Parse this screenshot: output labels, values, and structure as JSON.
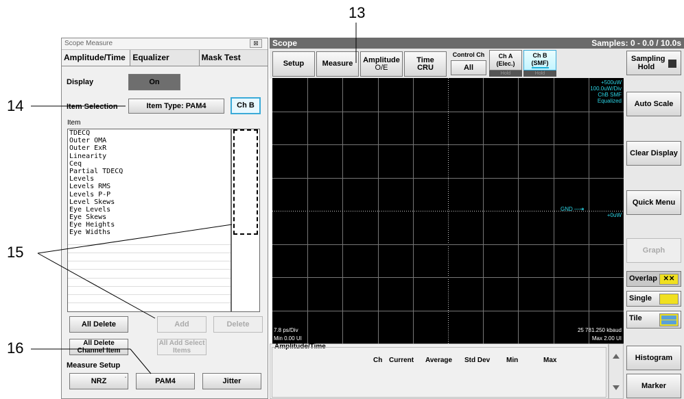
{
  "callouts": {
    "c13": "13",
    "c14": "14",
    "c15": "15",
    "c16": "16"
  },
  "left": {
    "title": "Scope Measure",
    "close": "⊠",
    "tabs": [
      "Amplitude/Time",
      "Equalizer",
      "Mask Test"
    ],
    "display_label": "Display",
    "display_value": "On",
    "item_selection_label": "Item Selection",
    "item_type": "Item Type: PAM4",
    "channel": "Ch B",
    "item_header": "Item",
    "items": [
      "TDECQ",
      "Outer OMA",
      "Outer ExR",
      "Linearity",
      "Ceq",
      "Partial TDECQ",
      "Levels",
      "Levels RMS",
      "Levels P-P",
      "Level Skews",
      "Eye Levels",
      "Eye Skews",
      "Eye Heights",
      "Eye Widths"
    ],
    "all_delete": "All Delete",
    "add": "Add",
    "delete": "Delete",
    "all_delete_channel": "All Delete Channel Item",
    "all_add_select": "All Add Select Items",
    "measure_setup": "Measure Setup",
    "setup_buttons": [
      "NRZ",
      "PAM4",
      "Jitter"
    ]
  },
  "scope": {
    "title": "Scope",
    "samples": "Samples: 0 - 0.0 / 10.0s",
    "toolbar": {
      "setup": "Setup",
      "measure": "Measure",
      "amplitude": "Amplitude",
      "amplitude_sub": "O/E",
      "time": "Time",
      "time_sub": "CRU",
      "control_ch": "Control Ch",
      "control_all": "All",
      "cha": "Ch A",
      "cha_sub": "(Elec.)",
      "cha_hold": "Hold",
      "chb": "Ch B",
      "chb_sub": "(SMF)",
      "chb_hold": "Hold"
    },
    "plot": {
      "top_right": [
        "+500uW",
        "100.0uW/Div",
        "ChB  SMF",
        "Equalized"
      ],
      "gnd": "GND",
      "zero": "+0uW",
      "bottom_left": [
        "7.8 ps/Div",
        "Min 0.00 UI"
      ],
      "bottom_right": [
        "25 781.250 kbaud",
        "Max 2.00 UI"
      ]
    },
    "measure_table": {
      "title": "Amplitude/Time",
      "columns": [
        "Ch",
        "Current",
        "Average",
        "Std Dev",
        "Min",
        "Max"
      ]
    },
    "right": {
      "sampling": "Sampling Hold",
      "auto_scale": "Auto Scale",
      "clear_display": "Clear Display",
      "quick_menu": "Quick Menu",
      "graph": "Graph",
      "overlap": "Overlap",
      "single": "Single",
      "tile": "Tile",
      "histogram": "Histogram",
      "marker": "Marker"
    },
    "colors": {
      "trace": "#2cd5e6",
      "accent": "#f0e020"
    }
  }
}
